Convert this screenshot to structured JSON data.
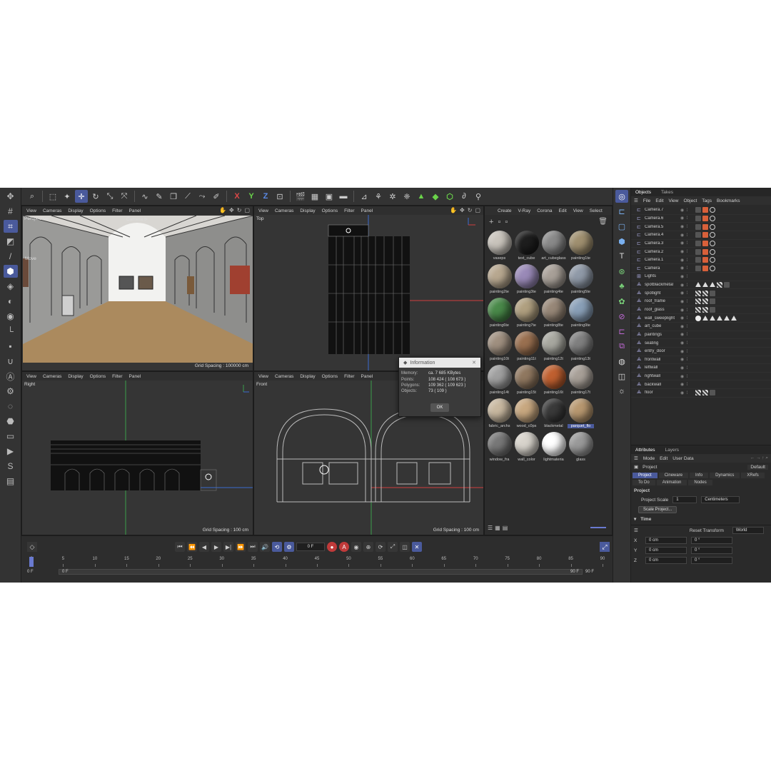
{
  "toolbar": {
    "axes": [
      "X",
      "Y",
      "Z"
    ]
  },
  "viewports": [
    {
      "menu": [
        "View",
        "Cameras",
        "Display",
        "Options",
        "Filter",
        "Panel"
      ],
      "label": "Perspective",
      "camera": "Camera ⊳",
      "grid": "Grid Spacing : 100000 cm",
      "move": "Move"
    },
    {
      "menu": [
        "View",
        "Cameras",
        "Display",
        "Options",
        "Filter",
        "Panel"
      ],
      "label": "Top",
      "grid": ""
    },
    {
      "menu": [
        "View",
        "Cameras",
        "Display",
        "Options",
        "Filter",
        "Panel"
      ],
      "label": "Right",
      "grid": "Grid Spacing : 100 cm"
    },
    {
      "menu": [
        "View",
        "Cameras",
        "Display",
        "Options",
        "Filter",
        "Panel"
      ],
      "label": "Front",
      "grid": "Grid Spacing : 100 cm"
    }
  ],
  "material_manager": {
    "menu": [
      "Create",
      "V-Ray",
      "Corona",
      "Edit",
      "View",
      "Select"
    ],
    "materials": [
      {
        "name": "vaseps",
        "color": "#c9c4bc"
      },
      {
        "name": "text_cube",
        "color": "#1e1e1e"
      },
      {
        "name": "art_cubeglass",
        "color": "#8a8a8a"
      },
      {
        "name": "painting1te",
        "color": "#a09070"
      },
      {
        "name": "painting2te",
        "color": "#b8a890"
      },
      {
        "name": "painting3te",
        "color": "#9a8ab8"
      },
      {
        "name": "painting4te",
        "color": "#a8a098"
      },
      {
        "name": "painting5te",
        "color": "#909aa8"
      },
      {
        "name": "painting6te",
        "color": "#4a8a4a"
      },
      {
        "name": "painting7te",
        "color": "#b0a080"
      },
      {
        "name": "painting8te",
        "color": "#988878"
      },
      {
        "name": "painting9te",
        "color": "#8aa0b8"
      },
      {
        "name": "painting10t",
        "color": "#a09080"
      },
      {
        "name": "painting11t",
        "color": "#9a7050"
      },
      {
        "name": "painting12t",
        "color": "#a8a8a0"
      },
      {
        "name": "painting13t",
        "color": "#808080"
      },
      {
        "name": "painting14t",
        "color": "#a0a0a0"
      },
      {
        "name": "painting15t",
        "color": "#907860"
      },
      {
        "name": "painting16t",
        "color": "#c06030"
      },
      {
        "name": "painting17t",
        "color": "#a8a098"
      },
      {
        "name": "fabric_archs",
        "color": "#c8b8a0"
      },
      {
        "name": "wood_c0ps",
        "color": "#c8a880"
      },
      {
        "name": "blackmetal",
        "color": "#3a3a3a"
      },
      {
        "name": "parquet_flo",
        "color": "#b89870"
      },
      {
        "name": "window_fra",
        "color": "#787878"
      },
      {
        "name": "wall_color",
        "color": "#d8d4cc"
      },
      {
        "name": "lightmateria",
        "color": "#ffffff"
      },
      {
        "name": "glass",
        "color": "#9a9a9a"
      }
    ],
    "selected": "parquet_flo"
  },
  "info_dialog": {
    "title": "Information",
    "rows": [
      {
        "k": "Memory:",
        "v": "ca. 7 685 KBytes"
      },
      {
        "k": "Points:",
        "v": "108 424 ( 108 673 )"
      },
      {
        "k": "Polygons:",
        "v": "109 362 ( 109 623 )"
      },
      {
        "k": "Objects:",
        "v": "73 ( 109 )"
      }
    ],
    "ok": "OK"
  },
  "object_manager": {
    "tabs": [
      "Objects",
      "Takes"
    ],
    "menu": [
      "File",
      "Edit",
      "View",
      "Object",
      "Tags",
      "Bookmarks"
    ],
    "objects": [
      {
        "name": "Camera.7",
        "tags": "cam"
      },
      {
        "name": "Camera.6",
        "tags": "cam"
      },
      {
        "name": "Camera.5",
        "tags": "cam"
      },
      {
        "name": "Camera.4",
        "tags": "cam"
      },
      {
        "name": "Camera.3",
        "tags": "cam"
      },
      {
        "name": "Camera.2",
        "tags": "cam"
      },
      {
        "name": "Camera.1",
        "tags": "cam"
      },
      {
        "name": "Camera",
        "tags": "cam"
      },
      {
        "name": "Lights",
        "tags": ""
      },
      {
        "name": "spotblackmetal",
        "tags": "tri"
      },
      {
        "name": "spotlight",
        "tags": "mat"
      },
      {
        "name": "roof_frame",
        "tags": "mat"
      },
      {
        "name": "roof_glass",
        "tags": "mat"
      },
      {
        "name": "wall_sweeplight",
        "tags": "wh"
      },
      {
        "name": "art_cube",
        "tags": ""
      },
      {
        "name": "paintings",
        "tags": ""
      },
      {
        "name": "seating",
        "tags": ""
      },
      {
        "name": "entry_door",
        "tags": ""
      },
      {
        "name": "frontwall",
        "tags": ""
      },
      {
        "name": "leftwall",
        "tags": ""
      },
      {
        "name": "rightwall",
        "tags": ""
      },
      {
        "name": "backwall",
        "tags": ""
      },
      {
        "name": "floor",
        "tags": "mat"
      }
    ]
  },
  "attributes": {
    "tabs": [
      "Attributes",
      "Layers"
    ],
    "menu": [
      "Mode",
      "Edit",
      "User Data"
    ],
    "object": "Project",
    "default_label": "Default",
    "subtabs": [
      "Project",
      "Cineware",
      "Info",
      "Dynamics",
      "XRefs",
      "To Do",
      "Animation",
      "Nodes"
    ],
    "section": "Project",
    "scale_label": "Project Scale",
    "scale_value": "1",
    "scale_unit": "Centimeters",
    "scale_button": "Scale Project...",
    "time_section": "Time",
    "reset_transform": "Reset Transform",
    "world": "World",
    "xyz": [
      {
        "axis": "X",
        "a": "0 cm",
        "b": "0 °"
      },
      {
        "axis": "Y",
        "a": "0 cm",
        "b": "0 °"
      },
      {
        "axis": "Z",
        "a": "0 cm",
        "b": "0 °"
      }
    ]
  },
  "timeline": {
    "current_frame": "0 F",
    "ticks": [
      "0",
      "5",
      "10",
      "15",
      "20",
      "25",
      "30",
      "35",
      "40",
      "45",
      "50",
      "55",
      "60",
      "65",
      "70",
      "75",
      "80",
      "85",
      "90"
    ],
    "start": "0 F",
    "range_start": "0 F",
    "range_end": "90 F",
    "end": "90 F"
  }
}
